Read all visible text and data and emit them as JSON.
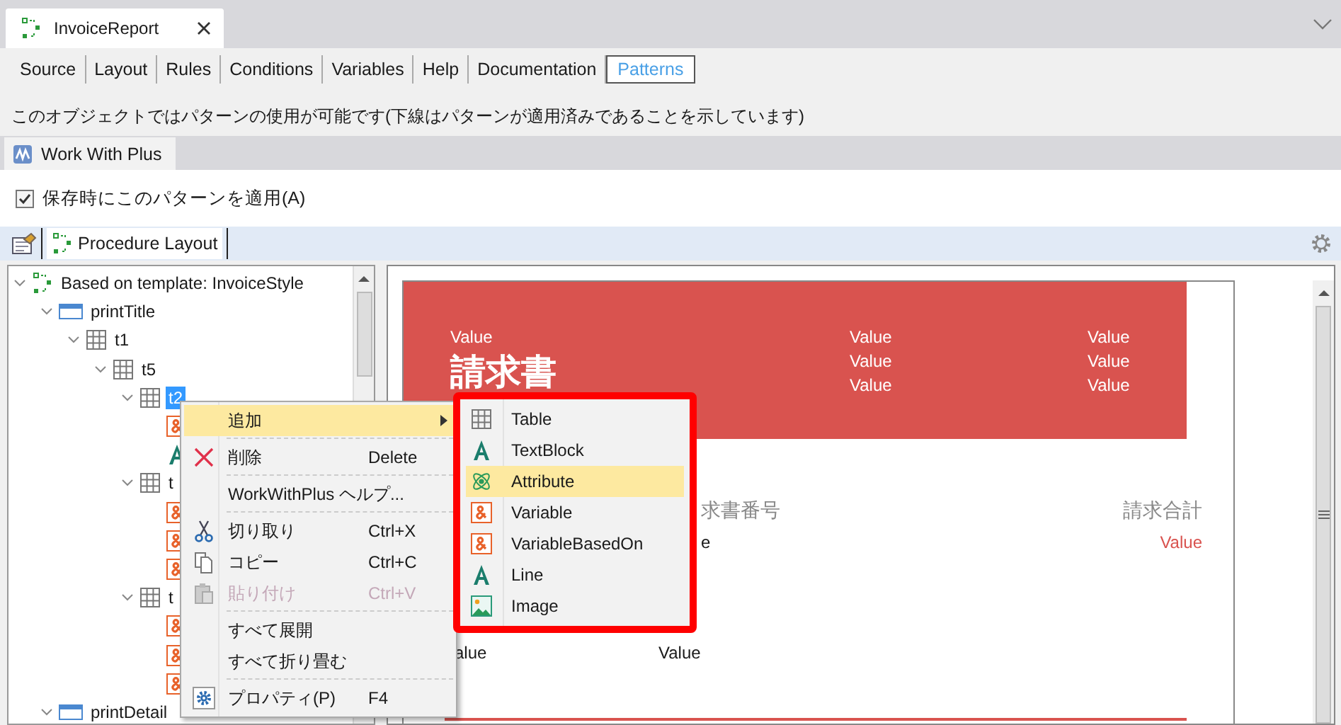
{
  "editor_tab": {
    "title": "InvoiceReport",
    "selected": true
  },
  "view_tabs": [
    {
      "label": "Source",
      "selected": false
    },
    {
      "label": "Layout",
      "selected": false
    },
    {
      "label": "Rules",
      "selected": false
    },
    {
      "label": "Conditions",
      "selected": false
    },
    {
      "label": "Variables",
      "selected": false
    },
    {
      "label": "Help",
      "selected": false
    },
    {
      "label": "Documentation",
      "selected": false
    },
    {
      "label": "Patterns",
      "selected": true
    }
  ],
  "info_text": "このオブジェクトではパターンの使用が可能です(下線はパターンが適用済みであることを示しています)",
  "pattern_tabs": [
    {
      "label": "Work With Plus",
      "selected": true
    }
  ],
  "apply_on_save": {
    "label": "保存時にこのパターンを適用(A)",
    "checked": true
  },
  "layout_tabs": [
    {
      "label": "Procedure Layout",
      "selected": true
    }
  ],
  "tree": [
    {
      "kind": "template",
      "label": "Based on template: InvoiceStyle",
      "expanded": true,
      "selected": false,
      "children": [
        {
          "kind": "band",
          "label": "printTitle",
          "expanded": true,
          "selected": false,
          "children": [
            {
              "kind": "table",
              "label": "t1",
              "expanded": true,
              "selected": false,
              "children": [
                {
                  "kind": "table",
                  "label": "t5",
                  "expanded": true,
                  "selected": false,
                  "children": [
                    {
                      "kind": "table",
                      "label": "t2",
                      "expanded": true,
                      "selected": true,
                      "children": [
                        {
                          "kind": "variable",
                          "selected": false
                        },
                        {
                          "kind": "text",
                          "selected": false
                        }
                      ]
                    },
                    {
                      "kind": "table",
                      "label": "t",
                      "expanded": true,
                      "selected": false,
                      "children": [
                        {
                          "kind": "variable",
                          "selected": false
                        },
                        {
                          "kind": "variable",
                          "selected": false
                        },
                        {
                          "kind": "variable",
                          "selected": false
                        }
                      ]
                    },
                    {
                      "kind": "table",
                      "label": "t",
                      "expanded": true,
                      "selected": false,
                      "children": [
                        {
                          "kind": "variable",
                          "selected": false
                        },
                        {
                          "kind": "variable",
                          "selected": false
                        },
                        {
                          "kind": "variable",
                          "selected": false
                        }
                      ]
                    }
                  ]
                }
              ]
            }
          ]
        },
        {
          "kind": "band",
          "label": "printDetail",
          "expanded": true,
          "selected": false
        }
      ]
    }
  ],
  "report": {
    "header": {
      "left": [
        "Value"
      ],
      "title": "請求書",
      "middle": [
        "Value",
        "Value",
        "Value"
      ],
      "right": [
        "Value",
        "Value",
        "Value"
      ]
    },
    "rows": [
      {
        "kind": "label",
        "cells": [
          "",
          "求書番号",
          "請求合計"
        ]
      },
      {
        "kind": "value",
        "cells": [
          "",
          "e",
          "Value"
        ]
      },
      {
        "kind": "plain",
        "cells": [
          "alue",
          "Value",
          ""
        ]
      }
    ]
  },
  "context_menu": [
    {
      "kind": "submenu",
      "label": "追加",
      "selected": true
    },
    {
      "kind": "separator"
    },
    {
      "kind": "delete",
      "label": "削除",
      "shortcut": "Delete",
      "disabled": false
    },
    {
      "kind": "separator"
    },
    {
      "kind": "plain",
      "label": "WorkWithPlus ヘルプ...",
      "disabled": false
    },
    {
      "kind": "separator"
    },
    {
      "kind": "cut",
      "label": "切り取り",
      "shortcut": "Ctrl+X",
      "disabled": false
    },
    {
      "kind": "copy",
      "label": "コピー",
      "shortcut": "Ctrl+C",
      "disabled": false
    },
    {
      "kind": "paste",
      "label": "貼り付け",
      "shortcut": "Ctrl+V",
      "disabled": true
    },
    {
      "kind": "separator"
    },
    {
      "kind": "plain",
      "label": "すべて展開",
      "disabled": false
    },
    {
      "kind": "plain",
      "label": "すべて折り畳む",
      "disabled": false
    },
    {
      "kind": "separator"
    },
    {
      "kind": "properties",
      "label": "プロパティ(P)",
      "shortcut": "F4",
      "disabled": false
    }
  ],
  "add_submenu": [
    {
      "kind": "table",
      "label": "Table",
      "selected": false
    },
    {
      "kind": "text",
      "label": "TextBlock",
      "selected": false
    },
    {
      "kind": "attribute",
      "label": "Attribute",
      "selected": true
    },
    {
      "kind": "variable",
      "label": "Variable",
      "selected": false
    },
    {
      "kind": "variable",
      "label": "VariableBasedOn",
      "selected": false
    },
    {
      "kind": "text",
      "label": "Line",
      "selected": false
    },
    {
      "kind": "image",
      "label": "Image",
      "selected": false
    }
  ]
}
